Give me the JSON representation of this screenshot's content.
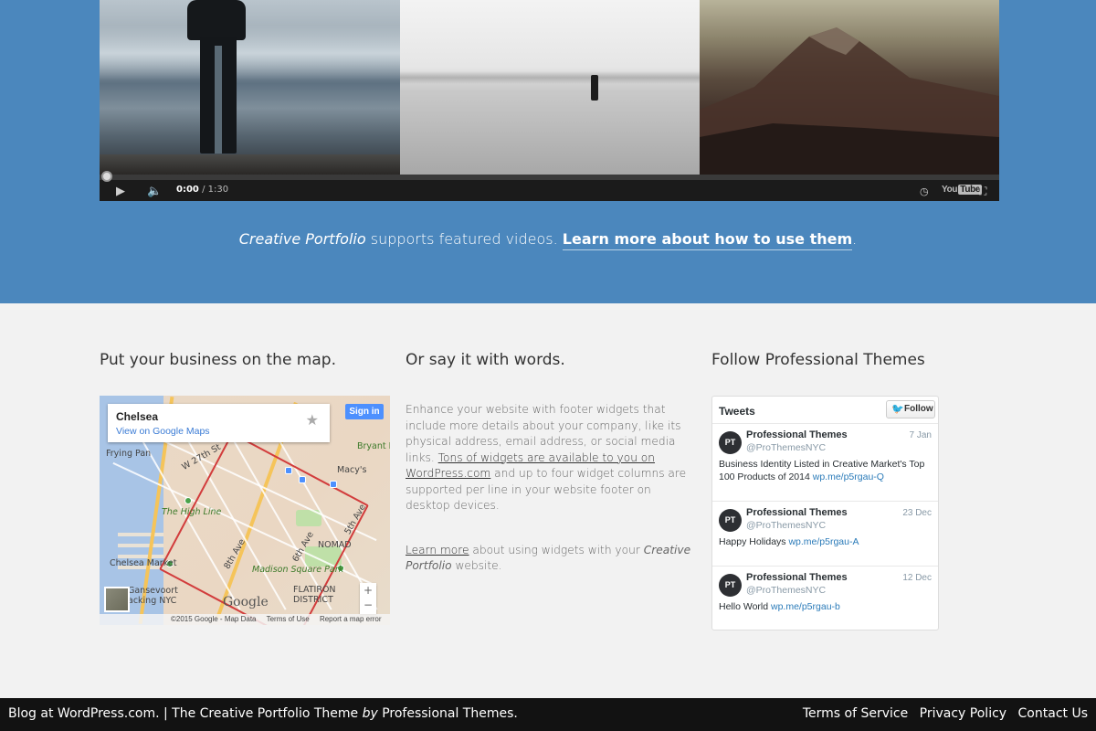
{
  "video": {
    "time_current": "0:00",
    "time_total": "/ 1:30",
    "youtube_label": "You",
    "youtube_tube": "Tube",
    "progress_fraction": 0.0
  },
  "caption": {
    "theme_name": "Creative Portfolio",
    "text": " supports featured videos. ",
    "link": "Learn more about how to use them",
    "end": "."
  },
  "map_widget": {
    "title": "Put your business on the map.",
    "place_name": "Chelsea",
    "view_link": "View on Google Maps",
    "sign_in": "Sign in",
    "labels": [
      "Frying Pan",
      "W 27th St",
      "Bryant P",
      "Macy's",
      "The High Line",
      "8th Ave",
      "6th Ave",
      "5th Ave",
      "NOMAD",
      "Chelsea Market",
      "Madison Square Park",
      "Gansevoort",
      "acking NYC",
      "FLATIRON",
      "DISTRICT"
    ],
    "logo": "Google",
    "attribution": [
      "©2015 Google - Map Data",
      "Terms of Use",
      "Report a map error"
    ],
    "zoom_in": "+",
    "zoom_out": "−"
  },
  "words_widget": {
    "title": "Or say it with words.",
    "p1_before": "Enhance your website with footer widgets that include more details about your company, like its physical address, email address, or social media links. ",
    "p1_link": "Tons of widgets are available to you on WordPress.com",
    "p1_after": " and up to four widget columns are supported per line in your website footer on desktop devices.",
    "p2_link": "Learn more",
    "p2_middle": " about using widgets with your ",
    "p2_theme": "Creative Portfolio",
    "p2_end": " website."
  },
  "twitter_widget": {
    "title": "Follow Professional Themes",
    "header": "Tweets",
    "follow": "Follow",
    "tweets": [
      {
        "avatar": "PT",
        "name": "Professional Themes",
        "handle": "@ProThemesNYC",
        "date": "7 Jan",
        "text": "Business Identity Listed in Creative Market's Top 100 Products of 2014 ",
        "link": "wp.me/p5rgau-Q"
      },
      {
        "avatar": "PT",
        "name": "Professional Themes",
        "handle": "@ProThemesNYC",
        "date": "23 Dec",
        "text": "Happy Holidays ",
        "link": "wp.me/p5rgau-A"
      },
      {
        "avatar": "PT",
        "name": "Professional Themes",
        "handle": "@ProThemesNYC",
        "date": "12 Dec",
        "text": "Hello World ",
        "link": "wp.me/p5rgau-b"
      }
    ]
  },
  "footer": {
    "blog": "Blog at WordPress.com.",
    "sep": " | ",
    "theme": "The Creative Portfolio Theme",
    "by": "by",
    "author": "Professional Themes.",
    "links": [
      "Terms of Service",
      "Privacy Policy",
      "Contact Us"
    ]
  },
  "colors": {
    "hero_blue": "#4b87bd",
    "page_bg": "#f2f2f2",
    "footer_bg": "#121212",
    "link_blue": "#2b7bb9"
  }
}
